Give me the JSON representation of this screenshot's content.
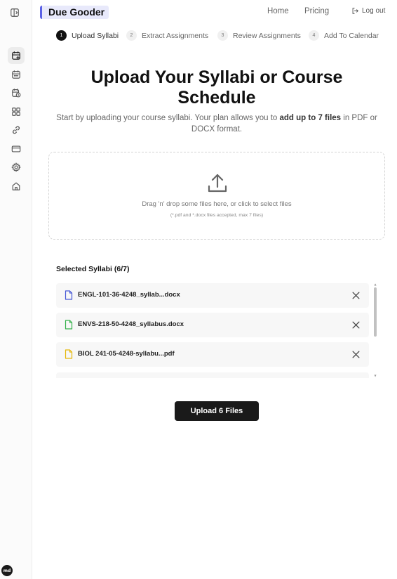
{
  "header": {
    "brand": "Due Gooder",
    "nav": {
      "home": "Home",
      "pricing": "Pricing",
      "logout": "Log out"
    }
  },
  "sidebar": {
    "items": [
      {
        "name": "calendar-plus-icon",
        "active": true
      },
      {
        "name": "calendar-icon",
        "active": false
      },
      {
        "name": "calendar-clock-icon",
        "active": false
      },
      {
        "name": "grid-icon",
        "active": false
      },
      {
        "name": "link-icon",
        "active": false
      },
      {
        "name": "credit-card-icon",
        "active": false
      },
      {
        "name": "gear-icon",
        "active": false
      },
      {
        "name": "home-icon",
        "active": false
      }
    ],
    "avatar": "md"
  },
  "steps": [
    {
      "num": "1",
      "label": "Upload Syllabi",
      "active": true
    },
    {
      "num": "2",
      "label": "Extract Assignments",
      "active": false
    },
    {
      "num": "3",
      "label": "Review Assignments",
      "active": false
    },
    {
      "num": "4",
      "label": "Add To Calendar",
      "active": false
    }
  ],
  "main": {
    "title_line1": "Upload Your Syllabi or Course",
    "title_line2": "Schedule",
    "subtitle_pre": "Start by uploading your course syllabi. Your plan allows you to ",
    "subtitle_bold": "add up to 7 files",
    "subtitle_post": " in PDF or DOCX format."
  },
  "dropzone": {
    "main_text": "Drag 'n' drop some files here, or click to select files",
    "sub_text": "(*.pdf and *.docx files accepted, max 7 files)"
  },
  "selected": {
    "heading": "Selected Syllabi (6/7)",
    "files": [
      {
        "name": "ENGL-101-36-4248_syllab...docx",
        "color": "#4a5bd6"
      },
      {
        "name": "ENVS-218-50-4248_syllabus.docx",
        "color": "#37b24d"
      },
      {
        "name": "BIOL 241-05-4248-syllabu...pdf",
        "color": "#e5b80b"
      }
    ]
  },
  "upload_button": "Upload 6 Files",
  "colors": {
    "accent": "#5b61e6",
    "brand_bg": "#e8e9fb",
    "button": "#1a1a1a"
  }
}
